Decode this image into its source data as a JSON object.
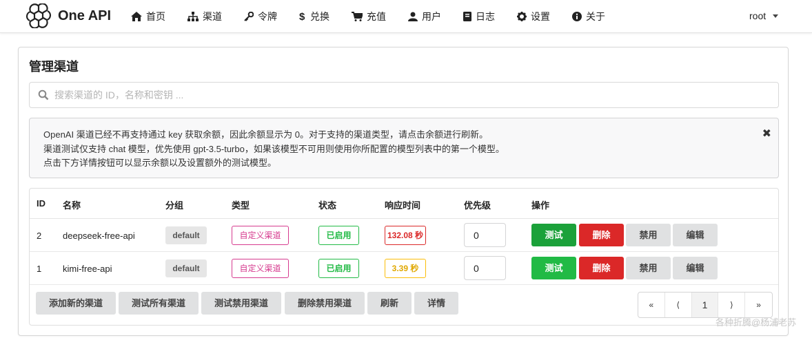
{
  "app": {
    "brand": "One API"
  },
  "nav": {
    "items": [
      {
        "label": "首页",
        "icon": "home-icon"
      },
      {
        "label": "渠道",
        "icon": "sitemap-icon"
      },
      {
        "label": "令牌",
        "icon": "key-icon"
      },
      {
        "label": "兑换",
        "icon": "dollar-icon"
      },
      {
        "label": "充值",
        "icon": "cart-icon"
      },
      {
        "label": "用户",
        "icon": "user-icon"
      },
      {
        "label": "日志",
        "icon": "book-icon"
      },
      {
        "label": "设置",
        "icon": "gear-icon"
      },
      {
        "label": "关于",
        "icon": "info-icon"
      }
    ],
    "user": "root"
  },
  "page": {
    "title": "管理渠道",
    "search_placeholder": "搜索渠道的 ID，名称和密钥 ...",
    "notice": [
      "OpenAI 渠道已经不再支持通过 key 获取余额，因此余额显示为 0。对于支持的渠道类型，请点击余额进行刷新。",
      "渠道测试仅支持 chat 模型，优先使用 gpt-3.5-turbo，如果该模型不可用则使用你所配置的模型列表中的第一个模型。",
      "点击下方详情按钮可以显示余额以及设置额外的测试模型。"
    ],
    "notice_close": "✖"
  },
  "table": {
    "headers": {
      "id": "ID",
      "name": "名称",
      "group": "分组",
      "type": "类型",
      "status": "状态",
      "resp": "响应时间",
      "priority": "优先级",
      "ops": "操作"
    },
    "rows": [
      {
        "id": "2",
        "name": "deepseek-free-api",
        "group": "default",
        "type": "自定义渠道",
        "status": "已启用",
        "resp": "132.08 秒",
        "resp_color": "#db2828",
        "priority": "0"
      },
      {
        "id": "1",
        "name": "kimi-free-api",
        "group": "default",
        "type": "自定义渠道",
        "status": "已启用",
        "resp": "3.39 秒",
        "resp_color": "#fbbd08",
        "priority": "0"
      }
    ],
    "row_buttons": {
      "test": "测试",
      "delete": "删除",
      "disable": "禁用",
      "edit": "编辑"
    }
  },
  "footer": {
    "buttons": {
      "add": "添加新的渠道",
      "test_all": "测试所有渠道",
      "test_disabled": "测试禁用渠道",
      "delete_disabled": "删除禁用渠道",
      "refresh": "刷新",
      "details": "详情"
    },
    "pager": {
      "first": "«",
      "prev": "⟨",
      "current": "1",
      "next": "⟩",
      "last": "»"
    }
  },
  "watermark": "各种折腾@杨浦老苏"
}
